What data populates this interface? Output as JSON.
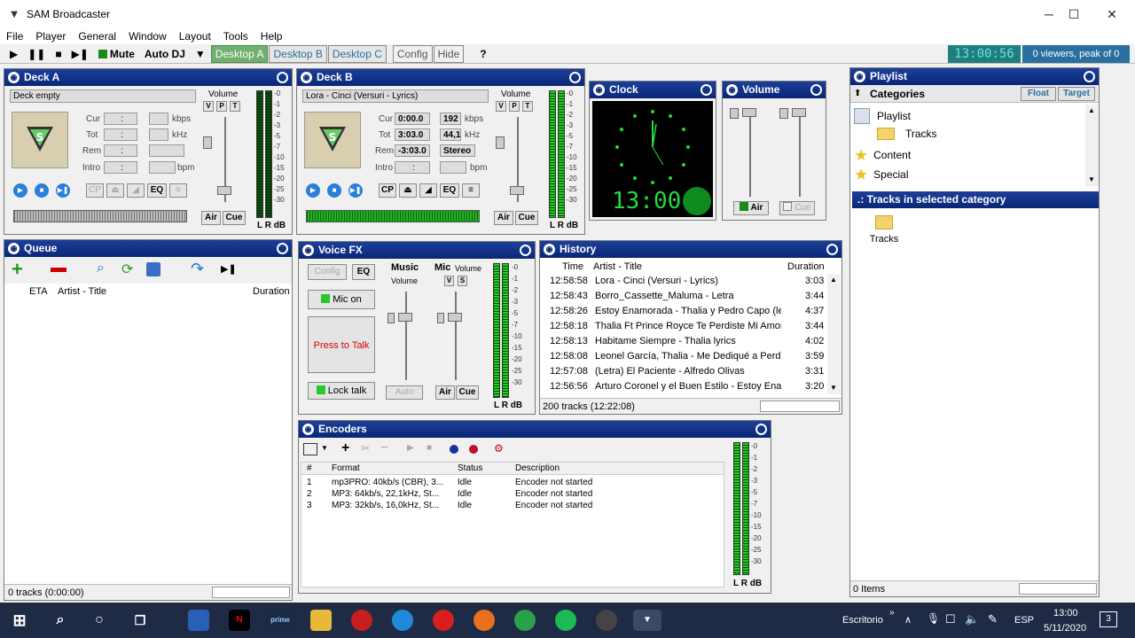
{
  "window": {
    "title": "SAM Broadcaster",
    "minimize": "─",
    "maximize": "☐",
    "close": "✕"
  },
  "menu": [
    "File",
    "Player",
    "General",
    "Window",
    "Layout",
    "Tools",
    "Help"
  ],
  "toolbar": {
    "play": "▶",
    "pause": "❚❚",
    "stop": "■",
    "next": "▶❚",
    "mute": "Mute",
    "autodj": "Auto DJ",
    "dropdown": "▼",
    "desktops": [
      "Desktop A",
      "Desktop B",
      "Desktop C"
    ],
    "config": "Config",
    "hide": "Hide",
    "help": "?",
    "clock": "13:00:56",
    "viewers": "0 viewers, peak of 0"
  },
  "deckA": {
    "title": "Deck A",
    "track": "Deck empty",
    "volume": "Volume",
    "vps": [
      "V",
      "P",
      "T"
    ],
    "labels": [
      "Cur",
      "Tot",
      "Rem",
      "Intro"
    ],
    "values": [
      ":",
      ":",
      ":",
      ":"
    ],
    "units": [
      "kbps",
      "kHz",
      "",
      "bpm"
    ],
    "unit_values": [
      "",
      "",
      "",
      ""
    ],
    "buttons": [
      "CP",
      "⏏",
      "◢",
      "EQ",
      "≡"
    ],
    "air": "Air",
    "cue": "Cue",
    "lr": "L R dB"
  },
  "deckB": {
    "title": "Deck B",
    "track": "Lora - Cinci (Versuri - Lyrics)",
    "volume": "Volume",
    "vps": [
      "V",
      "P",
      "T"
    ],
    "labels": [
      "Cur",
      "Tot",
      "Rem",
      "Intro"
    ],
    "values": [
      "0:00.0",
      "3:03.0",
      "-3:03.0",
      ":"
    ],
    "units": [
      "kbps",
      "kHz",
      "",
      "bpm"
    ],
    "unit_values": [
      "192",
      "44,1",
      "Stereo",
      ""
    ],
    "buttons": [
      "CP",
      "⏏",
      "◢",
      "EQ",
      "≡"
    ],
    "air": "Air",
    "cue": "Cue",
    "lr": "L R dB"
  },
  "db_scale": [
    "-0",
    "-1",
    "-2",
    "-3",
    "-5",
    "-7",
    "-10",
    "-15",
    "-20",
    "-25",
    "-30"
  ],
  "clock": {
    "title": "Clock",
    "digital": "13:00"
  },
  "volume": {
    "title": "Volume",
    "air": "Air",
    "cue": "Cue"
  },
  "queue": {
    "title": "Queue",
    "cols": [
      "ETA",
      "Artist - Title",
      "Duration"
    ],
    "status": "0 tracks (0:00:00)"
  },
  "voicefx": {
    "title": "Voice FX",
    "config": "Config",
    "eq": "EQ",
    "mic_on": "Mic on",
    "press_to_talk": "Press to Talk",
    "lock_talk": "Lock talk",
    "music": "Music",
    "music_volume": "Volume",
    "mic": "Mic",
    "mic_volume": "Volume",
    "vs": [
      "V",
      "S"
    ],
    "auto": "Auto",
    "air": "Air",
    "cue": "Cue",
    "lr": "L R dB"
  },
  "history": {
    "title": "History",
    "cols": [
      "Time",
      "Artist - Title",
      "Duration"
    ],
    "rows": [
      [
        "12:58:58",
        "Lora - Cinci (Versuri - Lyrics)",
        "3:03"
      ],
      [
        "12:58:43",
        "Borro_Cassette_Maluma - Letra",
        "3:44"
      ],
      [
        "12:58:26",
        "Estoy Enamorada - Thalia y Pedro Capo (letra)",
        "4:37"
      ],
      [
        "12:58:18",
        "Thalia Ft Prince Royce Te Perdiste Mi Amor ...",
        "3:44"
      ],
      [
        "12:58:13",
        "Habitame Siempre - Thalia lyrics",
        "4:02"
      ],
      [
        "12:58:08",
        "Leonel García, Thalia - Me Dediqué a Perderte",
        "3:59"
      ],
      [
        "12:57:08",
        "(Letra) El Paciente - Alfredo Olivas",
        "3:31"
      ],
      [
        "12:56:56",
        "Arturo Coronel y el Buen Estilo - Estoy Enam...",
        "3:20"
      ]
    ],
    "status": "200 tracks (12:22:08)"
  },
  "encoders": {
    "title": "Encoders",
    "cols": [
      "#",
      "Format",
      "Status",
      "Description"
    ],
    "rows": [
      [
        "1",
        "mp3PRO: 40kb/s (CBR), 3...",
        "Idle",
        "Encoder not started"
      ],
      [
        "2",
        "MP3: 64kb/s, 22,1kHz, St...",
        "Idle",
        "Encoder not started"
      ],
      [
        "3",
        "MP3: 32kb/s, 16,0kHz, St...",
        "Idle",
        "Encoder not started"
      ]
    ],
    "scale": [
      "-0",
      "-1",
      "-2",
      "-3",
      "-5",
      "-7",
      "-10",
      "-15",
      "-20",
      "-25",
      "-30"
    ],
    "lr": "L R dB"
  },
  "playlist": {
    "title": "Playlist",
    "categories": "Categories",
    "float": "Float",
    "target": "Target",
    "tree": [
      "Playlist",
      "Tracks",
      "Content",
      "Special"
    ],
    "tracks_header": ".: Tracks in selected category",
    "tracks_folder": "Tracks",
    "status": "0 Items"
  },
  "taskbar": {
    "lang_label": "Escritorio",
    "lang": "ESP",
    "time": "13:00",
    "date": "5/11/2020",
    "notif": "3"
  }
}
